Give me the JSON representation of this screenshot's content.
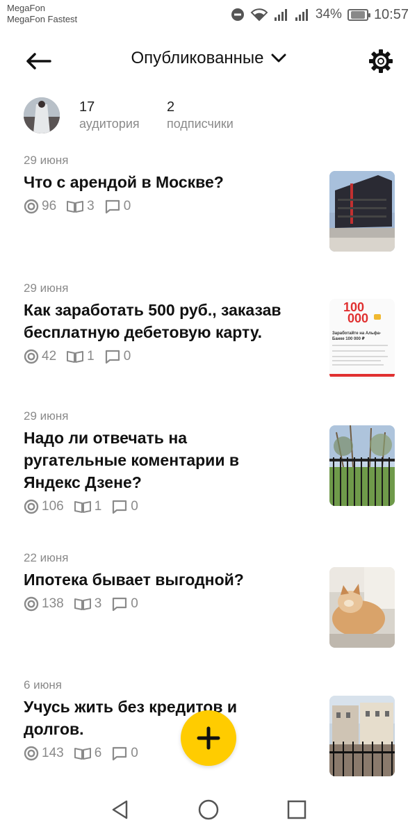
{
  "status_bar": {
    "carrier_1": "MegaFon",
    "carrier_2": "MegaFon Fastest",
    "battery_percent": "34%",
    "time": "10:57"
  },
  "header": {
    "title": "Опубликованные",
    "back_icon": "arrow-left-icon",
    "dropdown_icon": "chevron-down-icon",
    "settings_icon": "gear-icon"
  },
  "profile": {
    "audience_count": "17",
    "audience_label": "аудитория",
    "subscribers_count": "2",
    "subscribers_label": "подписчики"
  },
  "articles": [
    {
      "date": "29 июня",
      "title": "Что с арендой в Москве?",
      "views": "96",
      "reads": "3",
      "comments": "0"
    },
    {
      "date": "29 июня",
      "title": "Как заработать 500 руб., заказав бесплатную дебетовую карту.",
      "views": "42",
      "reads": "1",
      "comments": "0",
      "thumb_text_1": "100",
      "thumb_text_2": "000",
      "thumb_caption": "Заработайте на Альфа-Банке 100 000 ₽"
    },
    {
      "date": "29 июня",
      "title": "Надо ли отвечать на ругательные коментарии в Яндекс Дзене?",
      "views": "106",
      "reads": "1",
      "comments": "0"
    },
    {
      "date": "22 июня",
      "title": "Ипотека бывает выгодной?",
      "views": "138",
      "reads": "3",
      "comments": "0"
    },
    {
      "date": "6 июня",
      "title": "Учусь жить без кредитов и долгов.",
      "views": "143",
      "reads": "6",
      "comments": "0"
    }
  ],
  "fab": {
    "icon": "plus-icon",
    "color": "#ffcc00"
  },
  "nav": {
    "back_icon": "triangle-back-icon",
    "home_icon": "circle-home-icon",
    "recents_icon": "square-recents-icon"
  }
}
